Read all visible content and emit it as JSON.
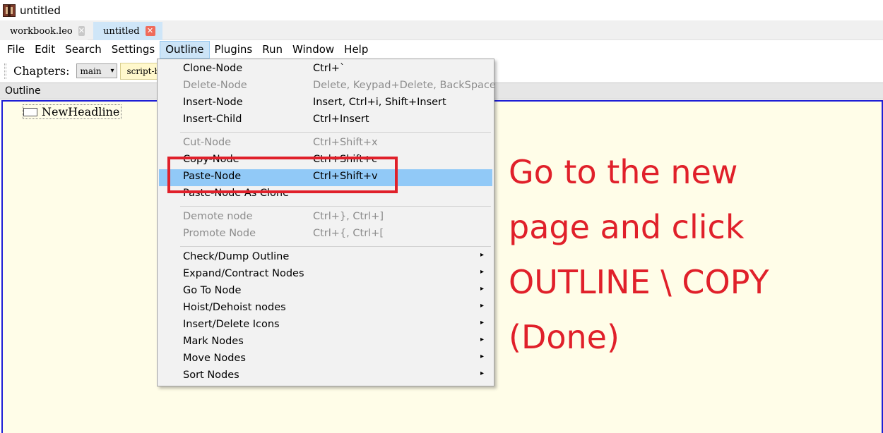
{
  "window": {
    "title": "untitled"
  },
  "tabs": [
    {
      "label": "workbook.leo",
      "close": "✕"
    },
    {
      "label": "untitled",
      "close": "✕"
    }
  ],
  "menubar": [
    "File",
    "Edit",
    "Search",
    "Settings",
    "Outline",
    "Plugins",
    "Run",
    "Window",
    "Help"
  ],
  "toolbar": {
    "chapters_label": "Chapters:",
    "chapter_select_value": "main",
    "chevron": "▾",
    "script_button_label": "script-button"
  },
  "outline": {
    "header": "Outline",
    "node_label": "NewHeadline"
  },
  "outline_menu": {
    "items": [
      {
        "label": "Clone-Node",
        "shortcut": "Ctrl+`",
        "enabled": true
      },
      {
        "label": "Delete-Node",
        "shortcut": "Delete, Keypad+Delete, BackSpace",
        "enabled": false
      },
      {
        "label": "Insert-Node",
        "shortcut": "Insert, Ctrl+i, Shift+Insert",
        "enabled": true
      },
      {
        "label": "Insert-Child",
        "shortcut": "Ctrl+Insert",
        "enabled": true
      },
      {
        "label": "Cut-Node",
        "shortcut": "Ctrl+Shift+x",
        "enabled": false
      },
      {
        "label": "Copy-Node",
        "shortcut": "Ctrl+Shift+c",
        "enabled": true
      },
      {
        "label": "Paste-Node",
        "shortcut": "Ctrl+Shift+v",
        "enabled": true,
        "highlighted": true
      },
      {
        "label": "Paste-Node As Clone",
        "shortcut": "",
        "enabled": true
      },
      {
        "label": "Demote node",
        "shortcut": "Ctrl+}, Ctrl+]",
        "enabled": false
      },
      {
        "label": "Promote Node",
        "shortcut": "Ctrl+{, Ctrl+[",
        "enabled": false
      },
      {
        "label": "Check/Dump Outline",
        "submenu": true
      },
      {
        "label": "Expand/Contract Nodes",
        "submenu": true
      },
      {
        "label": "Go To Node",
        "submenu": true
      },
      {
        "label": "Hoist/Dehoist nodes",
        "submenu": true
      },
      {
        "label": "Insert/Delete Icons",
        "submenu": true
      },
      {
        "label": "Mark Nodes",
        "submenu": true
      },
      {
        "label": "Move Nodes",
        "submenu": true
      },
      {
        "label": "Sort Nodes",
        "submenu": true
      }
    ],
    "submenu_arrow": "▸"
  },
  "annotation": {
    "lines": [
      "Go to the new",
      "page and click",
      "OUTLINE \\ COPY",
      "(Done)"
    ],
    "color": "#e0202a"
  },
  "colors": {
    "highlight": "#91c9f7",
    "outline_border": "#1e1ed6",
    "outline_bg": "#fffde8"
  }
}
